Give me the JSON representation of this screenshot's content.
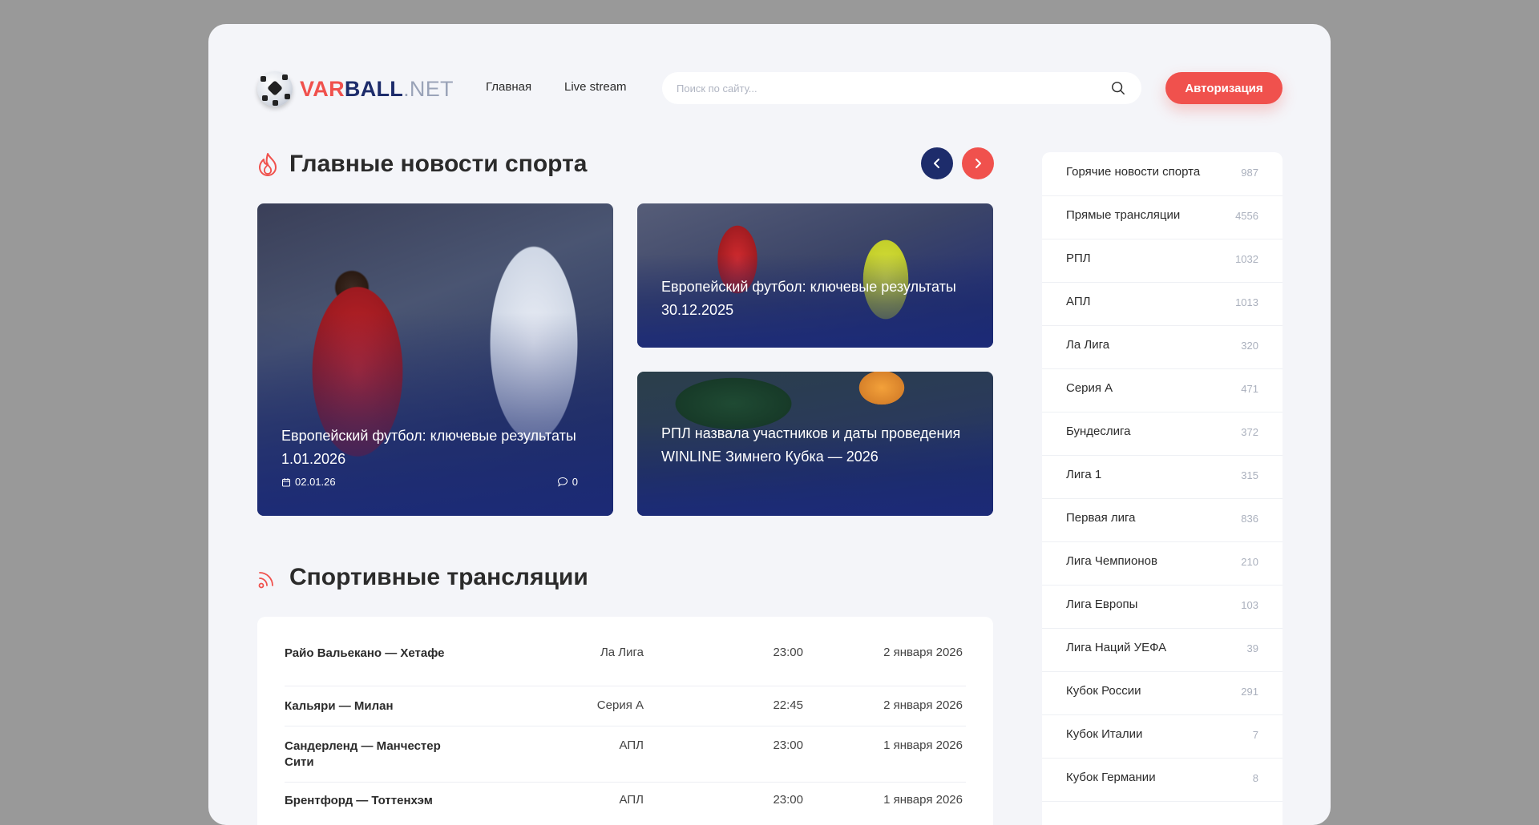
{
  "header": {
    "logo_var": "VAR",
    "logo_ball": "BALL",
    "logo_net": ".NET",
    "nav": [
      "Главная",
      "Live stream"
    ],
    "search_placeholder": "Поиск по сайту...",
    "auth_label": "Авторизация"
  },
  "news": {
    "title": "Главные новости спорта",
    "cards": [
      {
        "title": "Европейский футбол: ключевые результаты 1.01.2026",
        "date": "02.01.26",
        "comments": "0"
      },
      {
        "title": "Европейский футбол: ключевые результаты 30.12.2025"
      },
      {
        "title": "РПЛ назвала участников и даты проведения WINLINE Зимнего Кубка — 2026"
      }
    ]
  },
  "streams": {
    "title": "Спортивные трансляции",
    "rows": [
      {
        "match": "Райо Вальекано — Хетафе",
        "league": "Ла Лига",
        "time": "23:00",
        "date": "2 января 2026"
      },
      {
        "match": "Кальяри — Милан",
        "league": "Серия А",
        "time": "22:45",
        "date": "2 января 2026"
      },
      {
        "match": "Сандерленд — Манчестер Сити",
        "league": "АПЛ",
        "time": "23:00",
        "date": "1 января 2026"
      },
      {
        "match": "Брентфорд — Тоттенхэм",
        "league": "АПЛ",
        "time": "23:00",
        "date": "1 января 2026"
      }
    ]
  },
  "sidebar": {
    "items": [
      {
        "label": "Горячие новости спорта",
        "count": "987"
      },
      {
        "label": "Прямые трансляции",
        "count": "4556"
      },
      {
        "label": "РПЛ",
        "count": "1032"
      },
      {
        "label": "АПЛ",
        "count": "1013"
      },
      {
        "label": "Ла Лига",
        "count": "320"
      },
      {
        "label": "Серия А",
        "count": "471"
      },
      {
        "label": "Бундеслига",
        "count": "372"
      },
      {
        "label": "Лига 1",
        "count": "315"
      },
      {
        "label": "Первая лига",
        "count": "836"
      },
      {
        "label": "Лига Чемпионов",
        "count": "210"
      },
      {
        "label": "Лига Европы",
        "count": "103"
      },
      {
        "label": "Лига Наций УЕФА",
        "count": "39"
      },
      {
        "label": "Кубок России",
        "count": "291"
      },
      {
        "label": "Кубок Италии",
        "count": "7"
      },
      {
        "label": "Кубок Германии",
        "count": "8"
      }
    ]
  },
  "colors": {
    "accent": "#f0514d",
    "brand": "#1d2c6b",
    "muted": "#aab0bd"
  }
}
